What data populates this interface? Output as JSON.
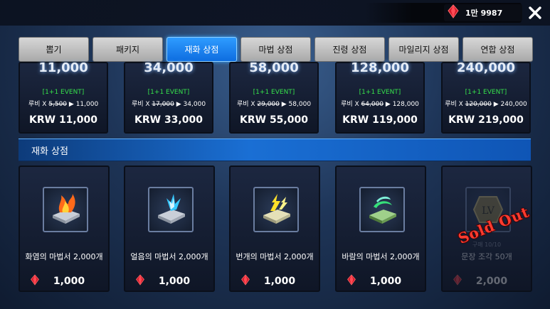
{
  "currency": {
    "amount": "1만 9987",
    "icon": "ruby-icon"
  },
  "tabs": [
    {
      "label": "뽑기",
      "active": false
    },
    {
      "label": "패키지",
      "active": false
    },
    {
      "label": "재화 상점",
      "active": true
    },
    {
      "label": "마법 상점",
      "active": false
    },
    {
      "label": "진령 상점",
      "active": false
    },
    {
      "label": "마일리지 상점",
      "active": false
    },
    {
      "label": "연합 상점",
      "active": false
    }
  ],
  "top_cards": [
    {
      "amount": "11,000",
      "event": "[1+1 EVENT]",
      "ruby_prefix": "루비 X ",
      "ruby_old": "5,500",
      "ruby_new": "▶ 11,000",
      "price": "KRW 11,000"
    },
    {
      "amount": "34,000",
      "event": "[1+1 EVENT]",
      "ruby_prefix": "루비 X ",
      "ruby_old": "17,000",
      "ruby_new": "▶ 34,000",
      "price": "KRW 33,000"
    },
    {
      "amount": "58,000",
      "event": "[1+1 EVENT]",
      "ruby_prefix": "루비 X ",
      "ruby_old": "29,000",
      "ruby_new": "▶ 58,000",
      "price": "KRW 55,000"
    },
    {
      "amount": "128,000",
      "event": "[1+1 EVENT]",
      "ruby_prefix": "루비 X ",
      "ruby_old": "64,000",
      "ruby_new": "▶ 128,000",
      "price": "KRW 119,000"
    },
    {
      "amount": "240,000",
      "event": "[1+1 EVENT]",
      "ruby_prefix": "루비 X ",
      "ruby_old": "120,000",
      "ruby_new": "▶ 240,000",
      "price": "KRW 219,000"
    }
  ],
  "section": {
    "title": "재화 상점"
  },
  "items": [
    {
      "name": "화염의 마법서 2,000개",
      "cost": "1,000",
      "icon": "fire-spellbook-icon",
      "color": "#ff6a1a"
    },
    {
      "name": "얼음의 마법서 2,000개",
      "cost": "1,000",
      "icon": "ice-spellbook-icon",
      "color": "#35c8ff"
    },
    {
      "name": "번개의 마법서 2,000개",
      "cost": "1,000",
      "icon": "lightning-spellbook-icon",
      "color": "#ffe12a"
    },
    {
      "name": "바람의 마법서 2,000개",
      "cost": "1,000",
      "icon": "wind-spellbook-icon",
      "color": "#36e07a"
    },
    {
      "name": "문장 조각 50개",
      "cost": "2,000",
      "icon": "emblem-fragment-icon",
      "sub_note": "구매 10/10",
      "sold_out": "Sold Out"
    }
  ]
}
